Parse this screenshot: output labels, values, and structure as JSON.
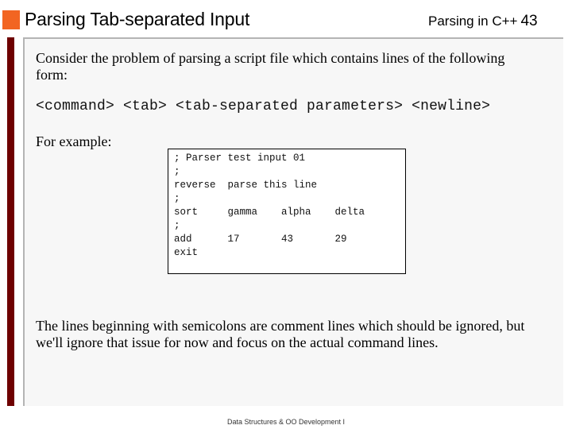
{
  "header": {
    "title": "Parsing Tab-separated Input",
    "section": "Parsing in C++",
    "page_number": "43",
    "accent_color": "#f26522",
    "bar_color": "#6e0000"
  },
  "content": {
    "intro": "Consider the problem of parsing a script file which contains lines of the following form:",
    "syntax": "<command> <tab> <tab-separated parameters> <newline>",
    "example_label": "For example:",
    "code_lines": [
      "; Parser test input 01",
      ";",
      "reverse  parse this line",
      ";",
      "sort     gamma    alpha    delta",
      ";",
      "add      17       43       29",
      "exit"
    ],
    "conclusion": "The lines beginning with semicolons are comment lines which should be ignored, but we'll ignore that issue for now and focus on the actual command lines."
  },
  "footer": {
    "text": "Data Structures & OO Development I"
  }
}
